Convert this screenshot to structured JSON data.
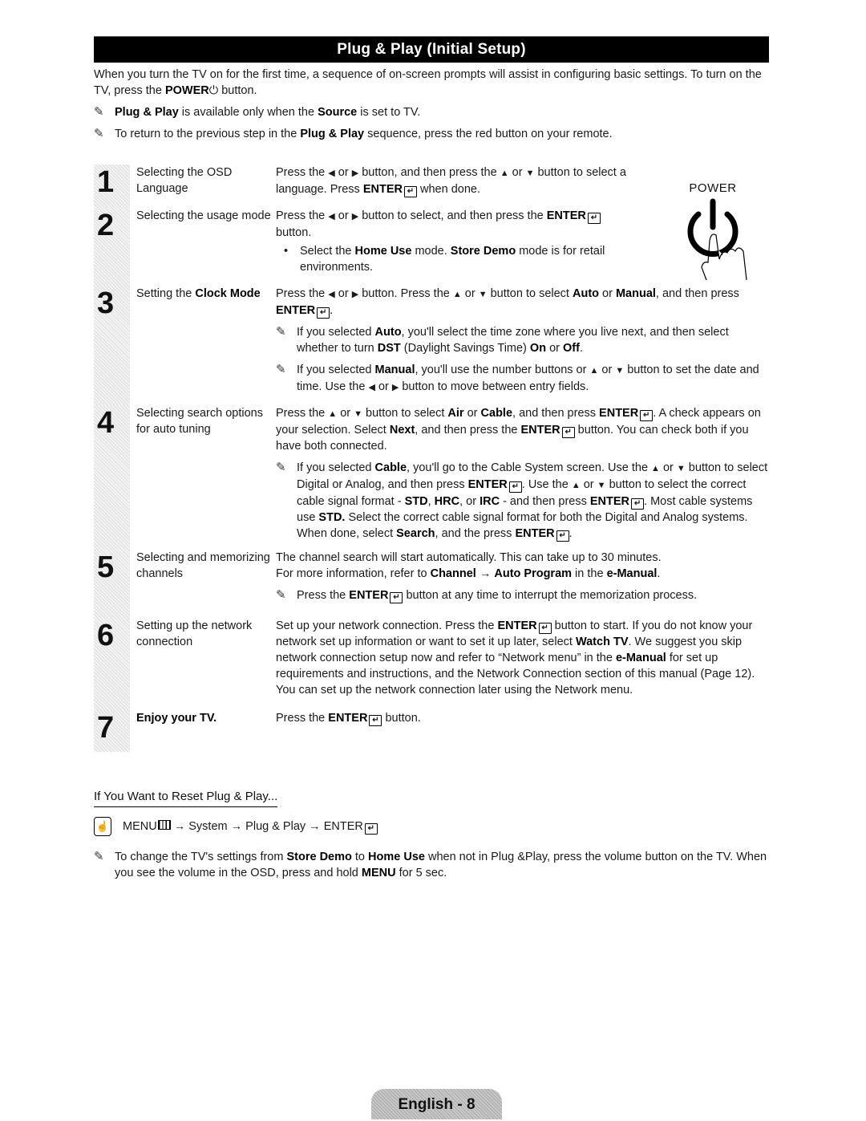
{
  "title": "Plug & Play (Initial Setup)",
  "intro": {
    "line1": "When you turn the TV on for the first time, a sequence of on-screen prompts will assist in configuring basic settings. To turn on the TV, press the ",
    "power_label": "POWER",
    "power_symbol": "⏻",
    "line1_end": " button.",
    "note1": {
      "b1": "Plug & Play",
      "t1": " is available only when the ",
      "b2": "Source",
      "t2": " is set to TV."
    },
    "note2": {
      "t1": "To return to the previous step in the ",
      "b1": "Plug & Play",
      "t2": " sequence, press the red button on your remote."
    }
  },
  "icons": {
    "note": "✎",
    "enter": "↵",
    "left": "◀",
    "right": "▶",
    "up": "▲",
    "down": "▼",
    "arrow": "→",
    "remote_hand": "☝"
  },
  "power_graphic": {
    "label": "POWER"
  },
  "steps": [
    {
      "number": "1",
      "title": "Selecting the OSD Language",
      "body": {
        "t1": "Press the ",
        "t2": " or ",
        "t3": " button, and then press the ",
        "t4": " or ",
        "t5": " button to select a language. Press ",
        "b1": "ENTER",
        "t6": " when done."
      }
    },
    {
      "number": "2",
      "title": "Selecting the usage mode",
      "body": {
        "t1": "Press the ",
        "t2": " or ",
        "t3": " button to select, and then press the ",
        "b1": "ENTER",
        "t4": " button."
      },
      "bullet": {
        "t1": "Select the ",
        "b1": "Home Use",
        "t2": " mode. ",
        "b2": "Store Demo",
        "t3": " mode is for retail environments."
      }
    },
    {
      "number": "3",
      "title_pre": "Setting the ",
      "title_bold": "Clock Mode",
      "body": {
        "t1": "Press the ",
        "t2": " or ",
        "t3": " button. Press the ",
        "t4": " or ",
        "t5": " button to select ",
        "b1": "Auto",
        "t6": " or ",
        "b2": "Manual",
        "t7": ", and then press ",
        "b3": "ENTER",
        "t8": "."
      },
      "note1": {
        "t1": "If you selected ",
        "b1": "Auto",
        "t2": ", you'll select the time zone where you live next, and then select whether to turn ",
        "b2": "DST",
        "t3": " (Daylight Savings Time) ",
        "b3": "On",
        "t4": " or ",
        "b4": "Off",
        "t5": "."
      },
      "note2": {
        "t1": "If you selected ",
        "b1": "Manual",
        "t2": ", you'll use the number buttons or ",
        "t3": " or ",
        "t4": " button to set the date and time. Use the ",
        "t5": " or ",
        "t6": " button to move between entry fields."
      }
    },
    {
      "number": "4",
      "title": "Selecting search options for auto tuning",
      "body": {
        "t1": "Press the ",
        "t2": " or ",
        "t3": " button to select ",
        "b1": "Air",
        "t4": " or ",
        "b2": "Cable",
        "t5": ", and then press ",
        "b3": "ENTER",
        "t6": ". A check appears on your selection. Select ",
        "b4": "Next",
        "t7": ", and then press the ",
        "b5": "ENTER",
        "t8": " button. You can check both if you have both connected."
      },
      "note1": {
        "t1": "If you selected ",
        "b1": "Cable",
        "t2": ", you'll go to the Cable System screen. Use the ",
        "t3": " or ",
        "t4": " button to select Digital or Analog, and then press ",
        "b2": "ENTER",
        "t5": ". Use the ",
        "t6": " or ",
        "t7": " button to select the correct cable signal format - ",
        "b3": "STD",
        "t8": ", ",
        "b4": "HRC",
        "t9": ", or ",
        "b5": "IRC",
        "t10": " - and then press ",
        "b6": "ENTER",
        "t11": ". Most cable systems use ",
        "b7": "STD.",
        "t12": " Select the correct cable signal format for both the Digital and Analog systems. When done, select ",
        "b8": "Search",
        "t13": ", and the press ",
        "b9": "ENTER",
        "t14": "."
      }
    },
    {
      "number": "5",
      "title": "Selecting and memorizing channels",
      "body1": "The channel search will start automatically. This can take up to 30 minutes.",
      "body2": {
        "t1": "For more information, refer to ",
        "b1": "Channel",
        "t2": " → ",
        "b2": "Auto Program",
        "t3": " in the ",
        "b3": "e-Manual",
        "t4": "."
      },
      "note1": {
        "t1": "Press the ",
        "b1": "ENTER",
        "t2": " button at any time to interrupt the memorization process."
      }
    },
    {
      "number": "6",
      "title": "Setting up the network connection",
      "body": {
        "t1": "Set up your network connection. Press the ",
        "b1": "ENTER",
        "t2": " button to start. If you do not know your network set up information or want to set it up later, select ",
        "b2": "Watch TV",
        "t3": ". We suggest you skip network connection setup now and refer to “Network menu” in the ",
        "b3": "e-Manual",
        "t4": " for set up requirements and instructions, and the Network Connection section of this manual (Page 12). You can set up the network connection later using the Network menu."
      }
    },
    {
      "number": "7",
      "title": "Enjoy your TV.",
      "body": {
        "t1": "Press the ",
        "b1": "ENTER",
        "t2": " button."
      }
    }
  ],
  "reset": {
    "heading": "If You Want to Reset Plug & Play...",
    "path": {
      "menu": "MENU",
      "arrow": " → ",
      "system": "System",
      "plug": "Plug & Play",
      "enter": "ENTER"
    },
    "note": {
      "t1": "To change the TV's settings from ",
      "b1": "Store Demo",
      "t2": " to ",
      "b2": "Home Use",
      "t3": " when not in Plug &Play, press the volume button on the TV. When you see the volume in the OSD, press and hold ",
      "b3": "MENU",
      "t4": " for 5 sec."
    }
  },
  "footer": {
    "page_label": "English - 8"
  }
}
